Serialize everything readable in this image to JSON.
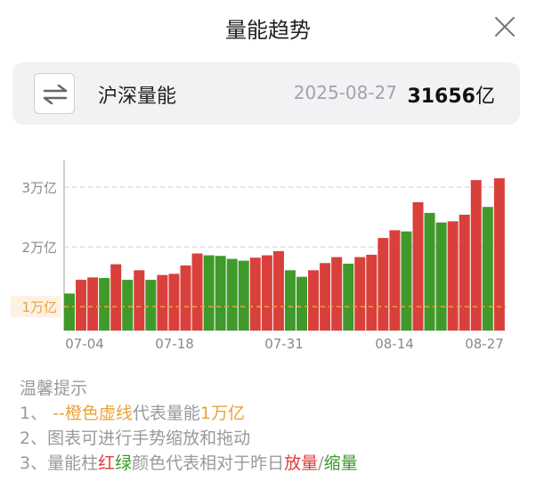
{
  "header": {
    "title": "量能趋势"
  },
  "summary": {
    "index_name": "沪深量能",
    "date": "2025-08-27",
    "value": "31656",
    "unit": "亿"
  },
  "colors": {
    "up": "#d9403b",
    "down": "#3f9a2b",
    "reference_line": "#e8a33a",
    "grid": "#cfcfcf"
  },
  "chart_data": {
    "type": "bar",
    "ylabel_ticks": [
      "1万亿",
      "2万亿",
      "3万亿"
    ],
    "ytick_values": [
      10000,
      20000,
      30000
    ],
    "x_tick_labels": [
      "07-04",
      "07-18",
      "07-31",
      "08-14",
      "08-27"
    ],
    "reference_line": {
      "value": 10000,
      "style": "dashed",
      "color": "orange"
    },
    "ylim": [
      6000,
      34500
    ],
    "values": [
      12200,
      14500,
      14900,
      14800,
      17100,
      14500,
      16100,
      14500,
      15300,
      15500,
      16900,
      18900,
      18600,
      18500,
      18000,
      17700,
      18200,
      18600,
      19300,
      16100,
      15000,
      16100,
      17300,
      18300,
      17200,
      18300,
      18700,
      21500,
      22800,
      22600,
      27500,
      25700,
      24100,
      24300,
      25400,
      31200,
      26700,
      31500
    ],
    "colors": [
      "down",
      "up",
      "up",
      "down",
      "up",
      "down",
      "up",
      "down",
      "up",
      "up",
      "up",
      "up",
      "down",
      "down",
      "down",
      "down",
      "up",
      "up",
      "up",
      "down",
      "down",
      "up",
      "up",
      "up",
      "down",
      "up",
      "up",
      "up",
      "up",
      "down",
      "up",
      "down",
      "down",
      "up",
      "up",
      "up",
      "down",
      "up"
    ]
  },
  "tips": {
    "title": "温馨提示",
    "line1_prefix": "1、 ",
    "line1_orange": "--橙色虚线",
    "line1_mid": "代表量能",
    "line1_value": "1万亿",
    "line2": "2、图表可进行手势缩放和拖动",
    "line3_prefix": "3、量能柱",
    "line3_red": "红",
    "line3_green": "绿",
    "line3_mid": "颜色代表相对于昨日",
    "line3_up": "放量",
    "line3_slash": "/",
    "line3_down": "缩量"
  }
}
